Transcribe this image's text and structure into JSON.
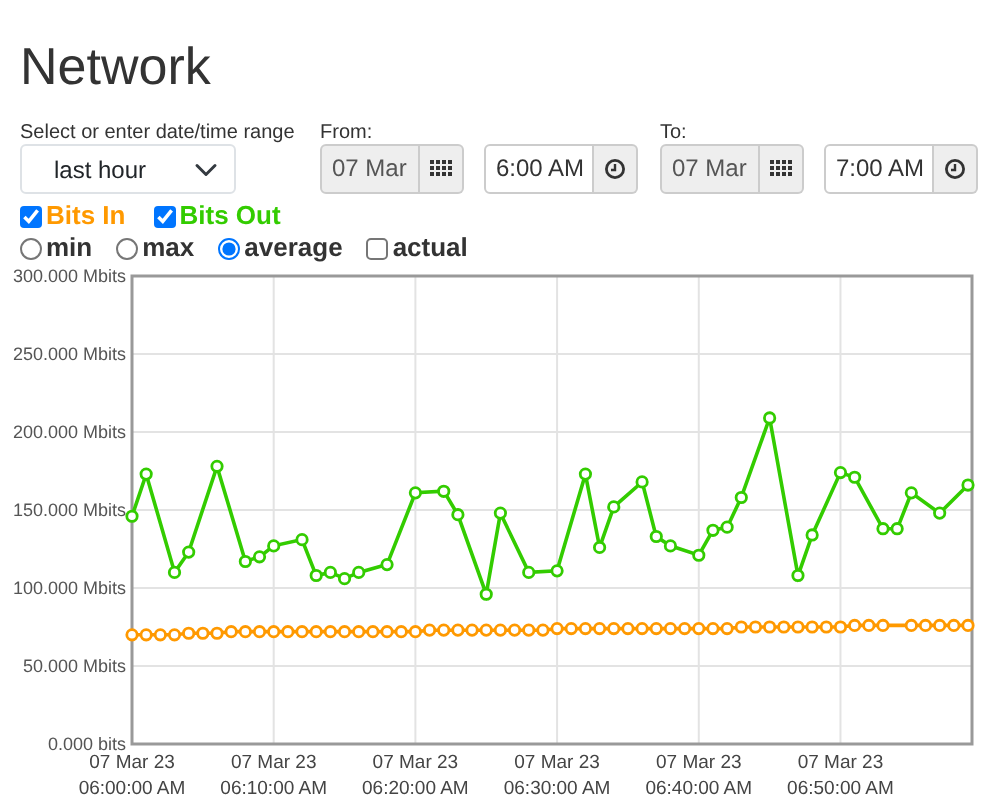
{
  "title": "Network",
  "range": {
    "label": "Select or enter date/time range",
    "value": "last hour"
  },
  "from": {
    "label": "From:",
    "date": "07 Mar",
    "time": "6:00 AM"
  },
  "to": {
    "label": "To:",
    "date": "07 Mar",
    "time": "7:00 AM"
  },
  "series_toggles": [
    {
      "checked": true
    },
    {
      "checked": true
    }
  ],
  "modes": [
    {
      "kind": "radio",
      "label": "min",
      "selected": false
    },
    {
      "kind": "radio",
      "label": "max",
      "selected": false
    },
    {
      "kind": "radio",
      "label": "average",
      "selected": true
    },
    {
      "kind": "checkbox",
      "label": "actual",
      "checked": false
    }
  ],
  "chart_data": {
    "type": "line",
    "grid": true,
    "ylim": [
      0,
      300
    ],
    "categories": [
      "07 Mar 23\n06:00:00 AM",
      null,
      null,
      null,
      null,
      null,
      null,
      null,
      null,
      null,
      "07 Mar 23\n06:10:00 AM",
      null,
      null,
      null,
      null,
      null,
      null,
      null,
      null,
      null,
      "07 Mar 23\n06:20:00 AM",
      null,
      null,
      null,
      null,
      null,
      null,
      null,
      null,
      null,
      "07 Mar 23\n06:30:00 AM",
      null,
      null,
      null,
      null,
      null,
      null,
      null,
      null,
      null,
      "07 Mar 23\n06:40:00 AM",
      null,
      null,
      null,
      null,
      null,
      null,
      null,
      null,
      null,
      "07 Mar 23\n06:50:00 AM",
      null,
      null,
      null,
      null,
      null,
      null,
      null,
      null,
      null
    ],
    "yticks": [
      {
        "value": 0,
        "label": "0.000 bits"
      },
      {
        "value": 50,
        "label": "50.000 Mbits"
      },
      {
        "value": 100,
        "label": "100.000 Mbits"
      },
      {
        "value": 150,
        "label": "150.000 Mbits"
      },
      {
        "value": 200,
        "label": "200.000 Mbits"
      },
      {
        "value": 250,
        "label": "250.000 Mbits"
      },
      {
        "value": 300,
        "label": "300.000 Mbits"
      }
    ],
    "series": [
      {
        "name": "Bits In",
        "color": "#ff9900",
        "marker": "circle",
        "values": [
          70,
          70,
          70,
          70,
          71,
          71,
          71,
          72,
          72,
          72,
          72,
          72,
          72,
          72,
          72,
          72,
          72,
          72,
          72,
          72,
          72,
          73,
          73,
          73,
          73,
          73,
          73,
          73,
          73,
          73,
          74,
          74,
          74,
          74,
          74,
          74,
          74,
          74,
          74,
          74,
          74,
          74,
          74,
          75,
          75,
          75,
          75,
          75,
          75,
          75,
          75,
          76,
          76,
          76,
          null,
          76,
          76,
          76,
          76,
          76
        ]
      },
      {
        "name": "Bits Out",
        "color": "#33cc00",
        "marker": "circle",
        "values": [
          146,
          173,
          null,
          110,
          123,
          null,
          178,
          null,
          117,
          120,
          127,
          null,
          131,
          108,
          110,
          106,
          110,
          null,
          115,
          null,
          161,
          null,
          162,
          147,
          null,
          96,
          148,
          null,
          110,
          null,
          111,
          null,
          173,
          126,
          152,
          null,
          168,
          133,
          127,
          null,
          121,
          137,
          139,
          158,
          null,
          209,
          null,
          108,
          134,
          null,
          174,
          171,
          null,
          138,
          138,
          161,
          null,
          148,
          null,
          166
        ]
      }
    ]
  }
}
